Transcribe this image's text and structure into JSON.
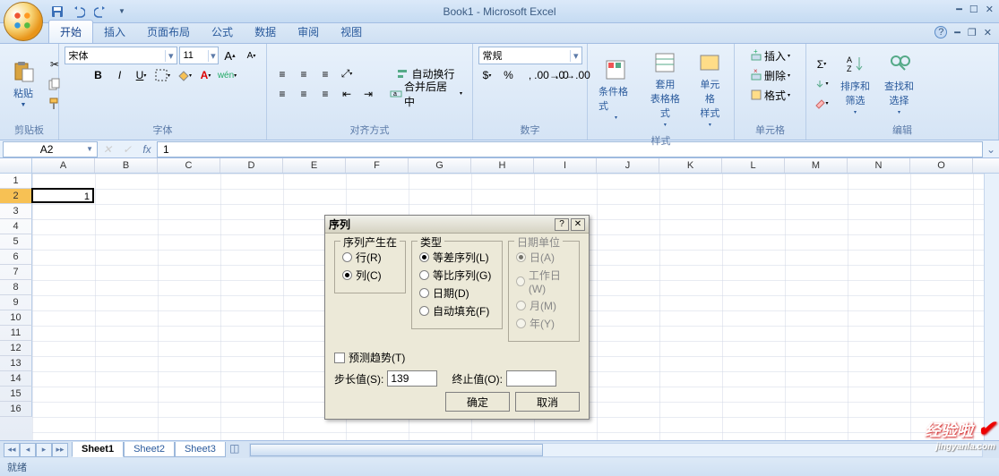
{
  "title": "Book1 - Microsoft Excel",
  "qat_icons": [
    "save",
    "undo",
    "redo"
  ],
  "tabs": [
    "开始",
    "插入",
    "页面布局",
    "公式",
    "数据",
    "审阅",
    "视图"
  ],
  "active_tab": 0,
  "ribbon": {
    "clipboard": {
      "label": "剪贴板",
      "paste": "粘贴"
    },
    "font": {
      "label": "字体",
      "name": "宋体",
      "size": "11"
    },
    "alignment": {
      "label": "对齐方式",
      "wrap": "自动换行",
      "merge": "合并后居中"
    },
    "number": {
      "label": "数字",
      "format": "常规"
    },
    "styles": {
      "label": "样式",
      "cond": "条件格式",
      "table": "套用\n表格格式",
      "cell": "单元格\n样式"
    },
    "cells": {
      "label": "单元格",
      "insert": "插入",
      "delete": "删除",
      "format": "格式"
    },
    "editing": {
      "label": "编辑",
      "sort": "排序和\n筛选",
      "find": "查找和\n选择"
    }
  },
  "name_box": "A2",
  "formula": "1",
  "columns": [
    "A",
    "B",
    "C",
    "D",
    "E",
    "F",
    "G",
    "H",
    "I",
    "J",
    "K",
    "L",
    "M",
    "N",
    "O"
  ],
  "rows": [
    "1",
    "2",
    "3",
    "4",
    "5",
    "6",
    "7",
    "8",
    "9",
    "10",
    "11",
    "12",
    "13",
    "14",
    "15",
    "16"
  ],
  "active_row": 2,
  "cell_value": "1",
  "sheets": [
    "Sheet1",
    "Sheet2",
    "Sheet3"
  ],
  "active_sheet": 0,
  "status": "就绪",
  "dialog": {
    "title": "序列",
    "group1": {
      "legend": "序列产生在",
      "rows": "行(R)",
      "cols": "列(C)"
    },
    "group2": {
      "legend": "类型",
      "arith": "等差序列(L)",
      "geom": "等比序列(G)",
      "date": "日期(D)",
      "auto": "自动填充(F)"
    },
    "group3": {
      "legend": "日期单位",
      "day": "日(A)",
      "weekday": "工作日(W)",
      "month": "月(M)",
      "year": "年(Y)"
    },
    "trend": "预测趋势(T)",
    "step_label": "步长值(S):",
    "step_value": "139",
    "stop_label": "终止值(O):",
    "stop_value": "",
    "ok": "确定",
    "cancel": "取消"
  },
  "watermark": {
    "main": "经验啦",
    "sub": "jingyanla.com"
  }
}
